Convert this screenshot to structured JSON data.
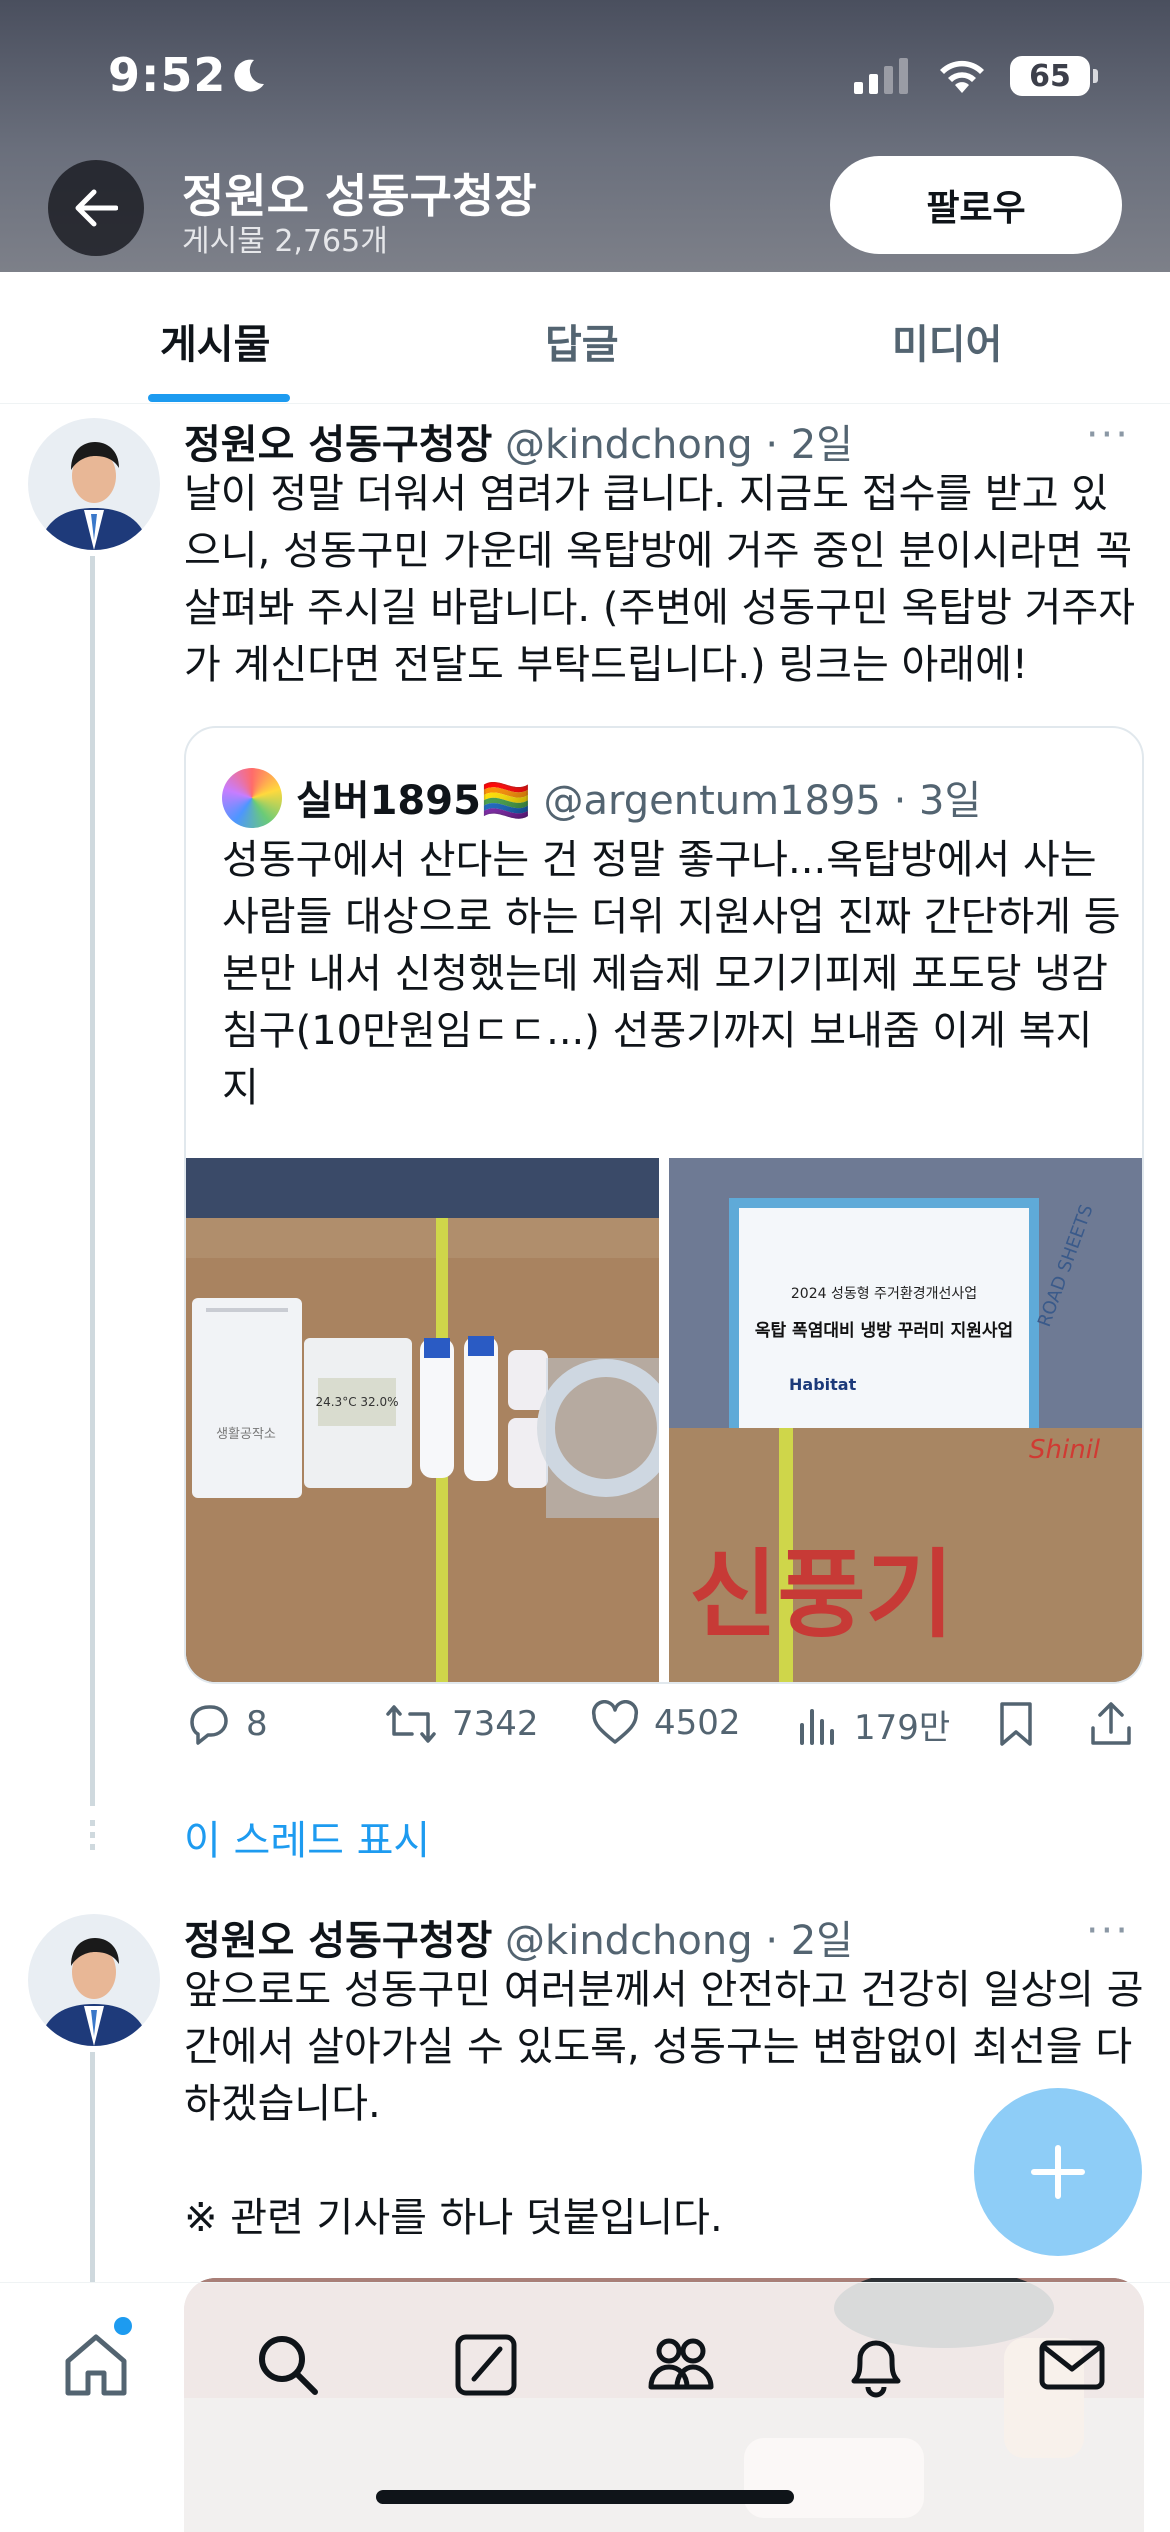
{
  "status_bar": {
    "time": "9:52",
    "battery": "65"
  },
  "header": {
    "name": "정원오 성동구청장",
    "post_count": "게시물 2,765개",
    "follow_label": "팔로우"
  },
  "tabs": [
    {
      "label": "게시물"
    },
    {
      "label": "답글"
    },
    {
      "label": "미디어"
    }
  ],
  "tweets": [
    {
      "name": "정원오 성동구청장",
      "handle": "@kindchong",
      "time": "2일",
      "text": "날이 정말 더워서 염려가 큽니다. 지금도 접수를 받고 있으니, 성동구민 가운데 옥탑방에 거주 중인 분이시라면 꼭 살펴봐 주시길 바랍니다. (주변에 성동구민 옥탑방 거주자가 계신다면 전달도 부탁드립니다.) 링크는 아래에!",
      "quote": {
        "name": "실버1895",
        "flag": "🏳️‍🌈",
        "handle": "@argentum1895",
        "time": "3일",
        "text": "성동구에서 산다는 건 정말 좋구나...옥탑방에서 사는 사람들 대상으로 하는 더위 지원사업 진짜 간단하게 등본만 내서 신청했는데 제습제 모기기피제 포도당 냉감 침구(10만원임ㄷㄷ...) 선풍기까지 보내줌 이게 복지지",
        "image_text": {
          "sign_line1": "2024 성동형 주거환경개선사업",
          "sign_line2": "옥탑 폭염대비 냉방 꾸러미 지원사업",
          "sign_brand": "Habitat",
          "box_text": "신풍기",
          "box_brand": "Shinil",
          "thermo_readout": "24.3°C 32.0%",
          "pack_label": "생활공작소",
          "sheets_label": "ROAD SHEETS"
        }
      },
      "stats": {
        "replies": "8",
        "retweets": "7342",
        "likes": "4502",
        "views": "179만"
      }
    },
    {
      "name": "정원오 성동구청장",
      "handle": "@kindchong",
      "time": "2일",
      "text": "앞으로도 성동구민 여러분께서 안전하고 건강히 일상의 공간에서 살아가실 수 있도록, 성동구는 변함없이 최선을 다하겠습니다.\n\n※ 관련 기사를 하나 덧붙입니다."
    }
  ],
  "show_thread_label": "이 스레드 표시",
  "colors": {
    "accent": "#1d9bf0",
    "fab": "#8ecdf7",
    "text": "#0f1419",
    "secondary": "#536471"
  }
}
